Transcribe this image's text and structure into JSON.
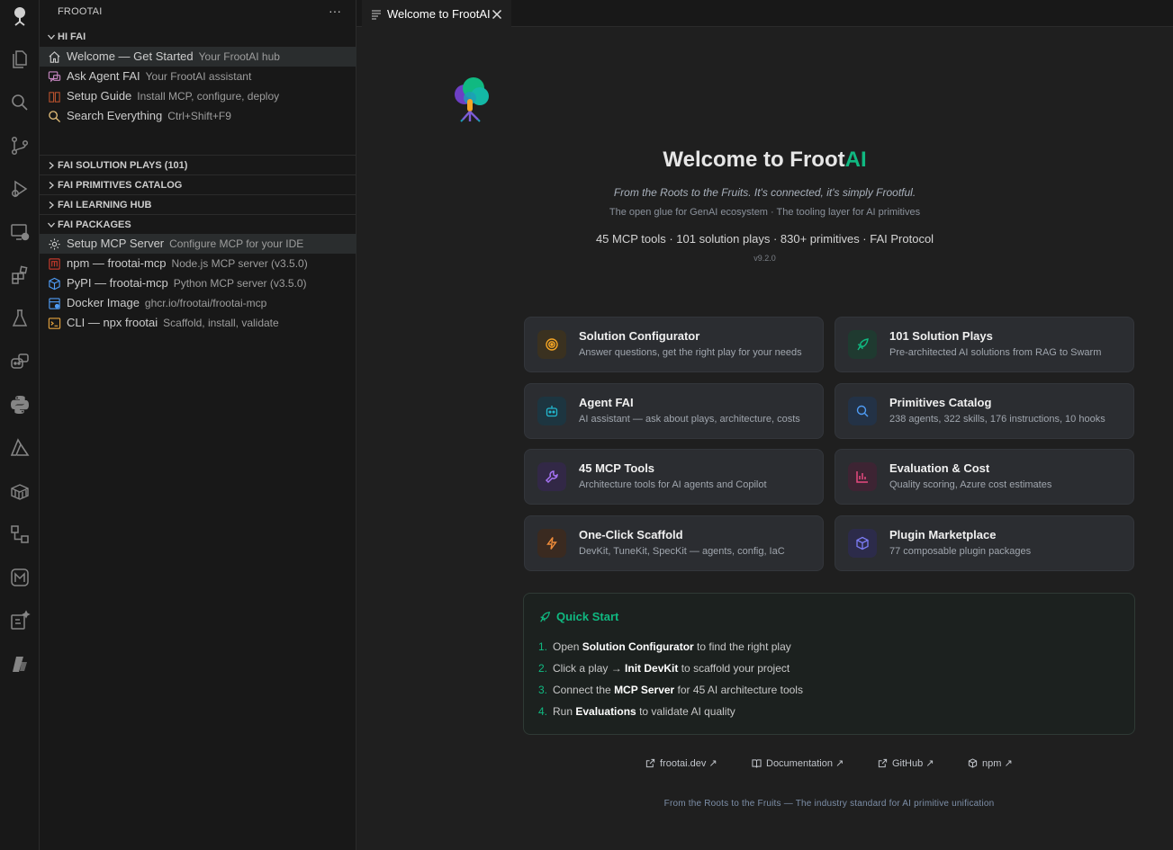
{
  "sidebar": {
    "title": "FROOTAI",
    "more": "···",
    "sections": {
      "hi": "HI FAI",
      "plays": "FAI SOLUTION PLAYS (101)",
      "primitives": "FAI PRIMITIVES CATALOG",
      "learning": "FAI LEARNING HUB",
      "packages": "FAI PACKAGES"
    },
    "hi_items": [
      {
        "label": "Welcome — Get Started",
        "desc": "Your FrootAI hub"
      },
      {
        "label": "Ask Agent FAI",
        "desc": "Your FrootAI assistant"
      },
      {
        "label": "Setup Guide",
        "desc": "Install MCP, configure, deploy"
      },
      {
        "label": "Search Everything",
        "desc": "Ctrl+Shift+F9"
      }
    ],
    "package_items": [
      {
        "label": "Setup MCP Server",
        "desc": "Configure MCP for your IDE"
      },
      {
        "label": "npm — frootai-mcp",
        "desc": "Node.js MCP server (v3.5.0)"
      },
      {
        "label": "PyPI — frootai-mcp",
        "desc": "Python MCP server (v3.5.0)"
      },
      {
        "label": "Docker Image",
        "desc": "ghcr.io/frootai/frootai-mcp"
      },
      {
        "label": "CLI — npx frootai",
        "desc": "Scaffold, install, validate"
      }
    ]
  },
  "tab": {
    "label": "Welcome to FrootAI"
  },
  "welcome": {
    "title_a": "Welcome to Froot",
    "title_b": "AI",
    "tagline": "From the Roots to the Fruits. It's connected, it's simply Frootful.",
    "tagline2": "The open glue for GenAI ecosystem · The tooling layer for AI primitives",
    "stats": "45 MCP tools · 101 solution plays · 830+ primitives · FAI Protocol",
    "version": "v9.2.0"
  },
  "cards": [
    {
      "title": "Solution Configurator",
      "desc": "Answer questions, get the right play for your needs"
    },
    {
      "title": "101 Solution Plays",
      "desc": "Pre-architected AI solutions from RAG to Swarm"
    },
    {
      "title": "Agent FAI",
      "desc": "AI assistant — ask about plays, architecture, costs"
    },
    {
      "title": "Primitives Catalog",
      "desc": "238 agents, 322 skills, 176 instructions, 10 hooks"
    },
    {
      "title": "45 MCP Tools",
      "desc": "Architecture tools for AI agents and Copilot"
    },
    {
      "title": "Evaluation & Cost",
      "desc": "Quality scoring, Azure cost estimates"
    },
    {
      "title": "One-Click Scaffold",
      "desc": "DevKit, TuneKit, SpecKit — agents, config, IaC"
    },
    {
      "title": "Plugin Marketplace",
      "desc": "77 composable plugin packages"
    }
  ],
  "quickstart": {
    "title": "Quick Start",
    "steps": [
      {
        "n": "1.",
        "a": "Open ",
        "b": "Solution Configurator",
        "c": " to find the right play"
      },
      {
        "n": "2.",
        "a": "Click a play → ",
        "b": "Init DevKit",
        "c": " to scaffold your project"
      },
      {
        "n": "3.",
        "a": "Connect the ",
        "b": "MCP Server",
        "c": " for 45 AI architecture tools"
      },
      {
        "n": "4.",
        "a": "Run ",
        "b": "Evaluations",
        "c": " to validate AI quality"
      }
    ]
  },
  "links": [
    {
      "label": "frootai.dev ↗"
    },
    {
      "label": "Documentation ↗"
    },
    {
      "label": "GitHub ↗"
    },
    {
      "label": "npm ↗"
    }
  ],
  "footer": "From the Roots to the Fruits — The industry standard for AI primitive unification",
  "colors": {
    "accent": "#10b981",
    "bg": "#1f1f1f",
    "sidebar": "#181818",
    "card": "#2b2d31"
  }
}
